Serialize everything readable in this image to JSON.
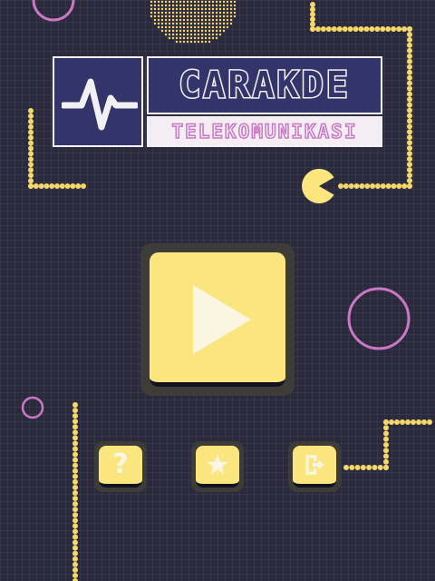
{
  "logo": {
    "icon": "heartbeat-pulse-icon"
  },
  "title": {
    "main": "CARAKDE",
    "subtitle": "TELEKOMUNIKASI"
  },
  "buttons": {
    "play": {
      "icon": "play-icon"
    },
    "help": {
      "icon": "question-icon"
    },
    "rate": {
      "icon": "star-icon"
    },
    "exit": {
      "icon": "exit-icon"
    }
  },
  "decor": {
    "mascot": "pacman-icon"
  },
  "colors": {
    "background": "#2b2a3d",
    "panel": "#33346a",
    "accent_yellow": "#fae57f",
    "dots": "#f5d86a",
    "pink": "#c978c4"
  }
}
